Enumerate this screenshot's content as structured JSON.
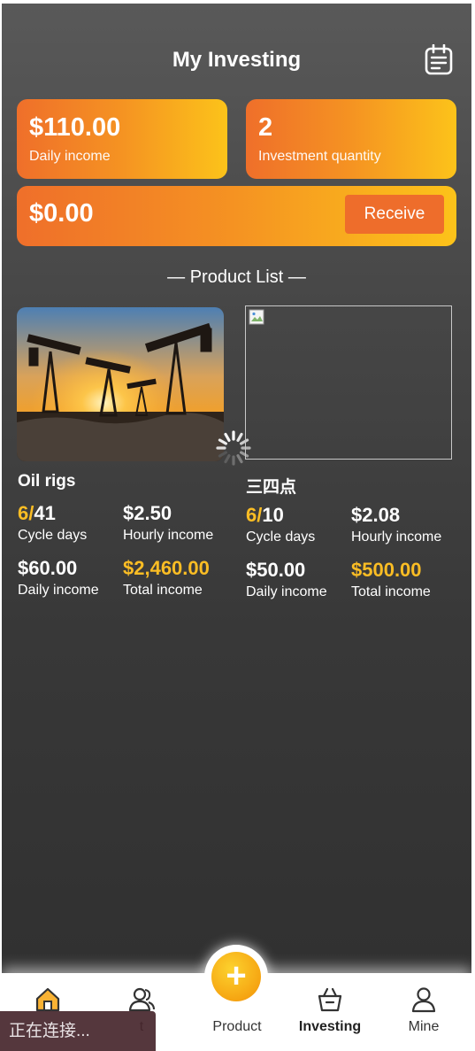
{
  "header": {
    "title": "My Investing",
    "notes_icon": "notepad-icon"
  },
  "summary": {
    "daily_income": {
      "value": "$110.00",
      "label": "Daily income"
    },
    "investment_quantity": {
      "value": "2",
      "label": "Investment quantity"
    },
    "balance": {
      "value": "$0.00",
      "button_label": "Receive"
    }
  },
  "product_list": {
    "title": "— Product List —",
    "items": [
      {
        "name": "Oil rigs",
        "cycle_done": "6/",
        "cycle_total": "41",
        "cycle_label": "Cycle days",
        "hourly": "$2.50",
        "hourly_label": "Hourly income",
        "daily": "$60.00",
        "daily_label": "Daily income",
        "total": "$2,460.00",
        "total_label": "Total income",
        "image": "oil-pumpjacks-sunset"
      },
      {
        "name": "三四点",
        "cycle_done": "6/",
        "cycle_total": "10",
        "cycle_label": "Cycle days",
        "hourly": "$2.08",
        "hourly_label": "Hourly income",
        "daily": "$50.00",
        "daily_label": "Daily income",
        "total": "$500.00",
        "total_label": "Total income",
        "image": "broken-image"
      }
    ]
  },
  "tabbar": {
    "items": [
      {
        "label": "",
        "icon": "home-icon"
      },
      {
        "label": "t",
        "icon": "team-icon"
      },
      {
        "label": "Product",
        "icon": "plus-icon"
      },
      {
        "label": "Investing",
        "icon": "basket-icon",
        "active": true
      },
      {
        "label": "Mine",
        "icon": "user-icon"
      }
    ]
  },
  "toast": {
    "text": "正在连接..."
  },
  "colors": {
    "accent_start": "#ef6f2a",
    "accent_end": "#fcc31a",
    "gold_text": "#fbbd24",
    "button": "#ee6d2b"
  }
}
